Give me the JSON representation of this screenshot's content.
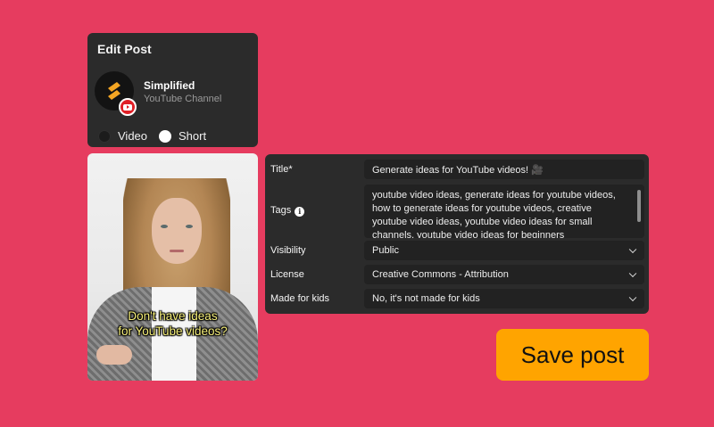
{
  "edit_card": {
    "title": "Edit Post",
    "channel_name": "Simplified",
    "channel_type": "YouTube Channel",
    "avatar_icon": "simplified-logo-icon",
    "badge_icon": "youtube-icon",
    "post_types": [
      {
        "label": "Video",
        "selected": false
      },
      {
        "label": "Short",
        "selected": true
      }
    ]
  },
  "video": {
    "caption_line1": "Don't have ideas",
    "caption_line2": "for YouTube videos?"
  },
  "form": {
    "title_label": "Title*",
    "title_value": "Generate ideas for YouTube videos! 🎥",
    "tags_label": "Tags",
    "tags_value": "youtube video ideas, generate ideas for youtube videos, how to generate ideas for youtube videos, creative youtube video ideas, youtube video ideas for small channels, youtube video ideas for beginners",
    "visibility_label": "Visibility",
    "visibility_value": "Public",
    "license_label": "License",
    "license_value": "Creative Commons - Attribution",
    "kids_label": "Made for kids",
    "kids_value": "No, it's not made for kids"
  },
  "actions": {
    "save_label": "Save post"
  },
  "colors": {
    "background": "#e63c5f",
    "card": "#2b2b2b",
    "field": "#222222",
    "accent": "#ffa400",
    "caption": "#f7f07a"
  }
}
